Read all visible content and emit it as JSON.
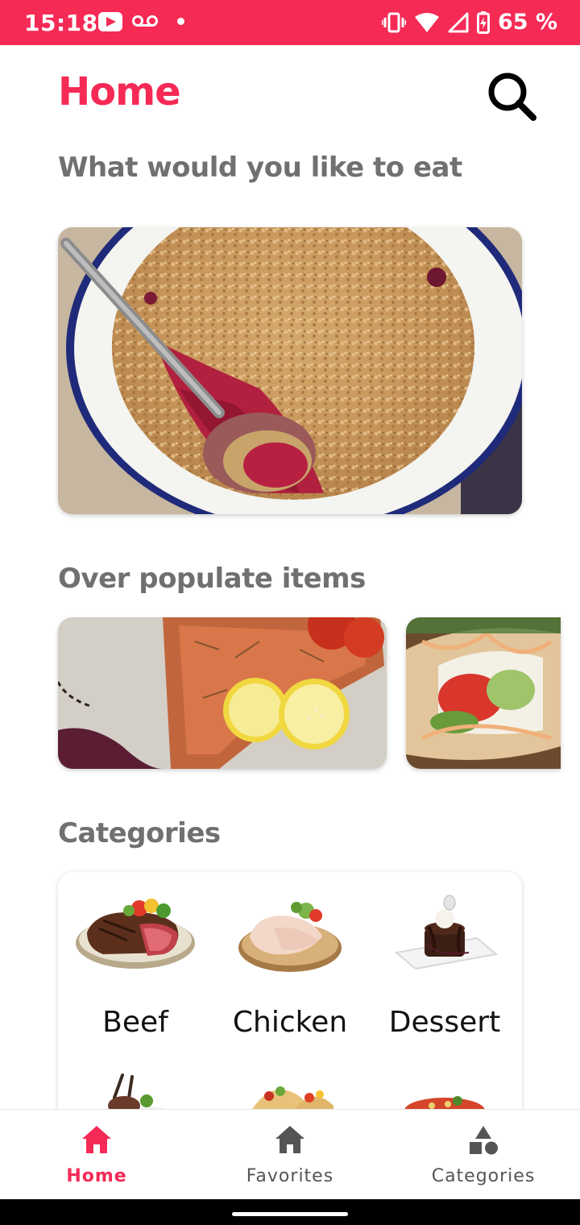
{
  "status_bar": {
    "time": "15:18",
    "battery_percent": "65 %",
    "icons": [
      "youtube-icon",
      "voicemail-icon",
      "notification-dot-icon",
      "vibrate-icon",
      "wifi-icon",
      "signal-icon",
      "battery-charging-icon"
    ],
    "background_color": "#f52a55"
  },
  "header": {
    "title": "Home",
    "search_icon": "search-icon"
  },
  "sections": {
    "hero_title": "What would you like to eat",
    "popular_title": "Over populate items",
    "categories_title": "Categories"
  },
  "hero": {
    "image": "crumble-dessert-image"
  },
  "popular_items": [
    {
      "image": "grilled-salmon-lemon-image"
    },
    {
      "image": "fish-tacos-image"
    }
  ],
  "categories": [
    {
      "label": "Beef",
      "image": "beef-steak-image"
    },
    {
      "label": "Chicken",
      "image": "chicken-leg-image"
    },
    {
      "label": "Dessert",
      "image": "chocolate-cake-image"
    },
    {
      "label": "",
      "image": "lamb-chops-image"
    },
    {
      "label": "",
      "image": "tacos-image"
    },
    {
      "label": "",
      "image": "pasta-image"
    }
  ],
  "bottom_nav": [
    {
      "label": "Home",
      "icon": "home-icon",
      "active": true
    },
    {
      "label": "Favorites",
      "icon": "home-icon",
      "active": false
    },
    {
      "label": "Categories",
      "icon": "shapes-icon",
      "active": false
    }
  ],
  "colors": {
    "accent": "#f52a55",
    "section_title": "#707070",
    "nav_inactive": "#555555"
  }
}
